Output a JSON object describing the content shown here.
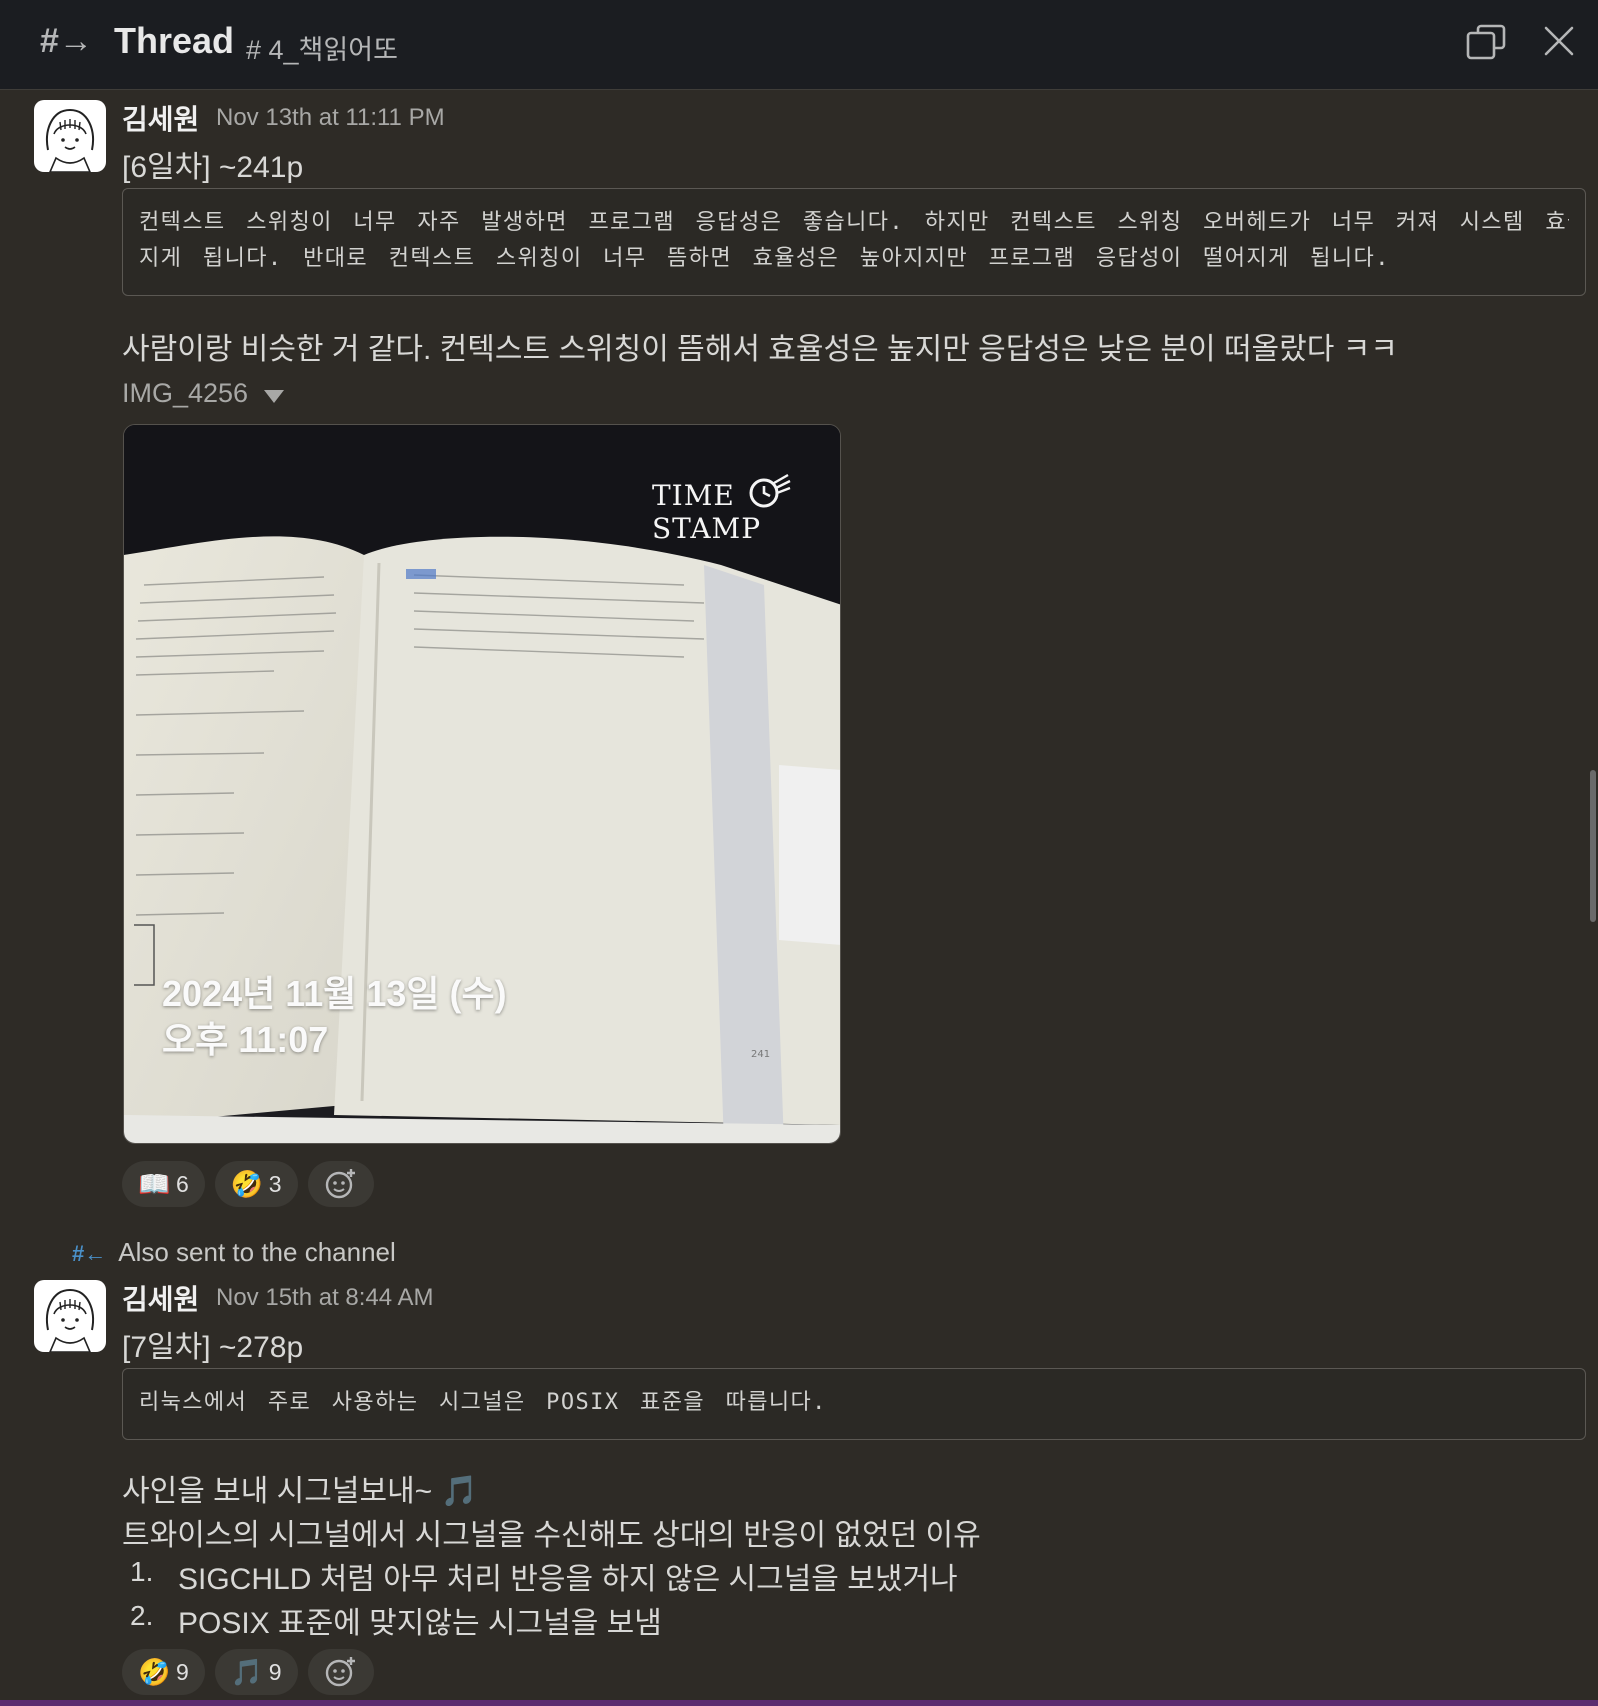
{
  "header": {
    "title": "Thread",
    "channel": "# 4_책읽어또"
  },
  "messages": [
    {
      "author": "김세원",
      "time": "Nov 13th at 11:11 PM",
      "heading": "[6일차] ~241p",
      "quote_lines": [
        "컨텍스트 스위칭이 너무 자주 발생하면 프로그램 응답성은 좋습니다. 하지만 컨텍스트 스위칭 오버헤드가 너무 커져 시스템 효율성이 떨어",
        "지게 됩니다. 반대로 컨텍스트 스위칭이 너무 뜸하면 효율성은 높아지지만 프로그램 응답성이 떨어지게 됩니다."
      ],
      "body": "사람이랑 비슷한 거 같다. 컨텍스트 스위칭이 뜸해서 효율성은 높지만 응답성은 낮은 분이 떠올랐다 ㅋㅋ",
      "file": {
        "name": "IMG_4256",
        "stamp_label": "TIME STAMP",
        "date_line": "2024년 11월 13일 (수)",
        "time_line": "오후 11:07",
        "page_number": "241"
      },
      "reactions": [
        {
          "emoji": "📖",
          "count": "6"
        },
        {
          "emoji": "🤣",
          "count": "3"
        }
      ]
    },
    {
      "also_sent": "Also sent to the channel",
      "author": "김세원",
      "time": "Nov 15th at 8:44 AM",
      "heading": "[7일차] ~278p",
      "quote_lines": [
        "리눅스에서 주로 사용하는 시그널은 POSIX 표준을 따릅니다."
      ],
      "body_lines": [
        "사인을 보내 시그널보내~ 🎵",
        "트와이스의 시그널에서 시그널을 수신해도 상대의 반응이 없었던 이유"
      ],
      "list": [
        {
          "num": "1.",
          "text": "SIGCHLD 처럼 아무 처리 반응을 하지 않은 시그널을 보냈거나"
        },
        {
          "num": "2.",
          "text": "POSIX 표준에 맞지않는 시그널을 보냄"
        }
      ],
      "reactions": [
        {
          "emoji": "🤣",
          "count": "9"
        },
        {
          "emoji": "🎵",
          "count": "9"
        }
      ]
    }
  ],
  "icons": {
    "thread": "#→",
    "popout": "popout-icon",
    "close": "close-icon",
    "add_reaction": "add-reaction-icon",
    "also_sent": "#←"
  }
}
